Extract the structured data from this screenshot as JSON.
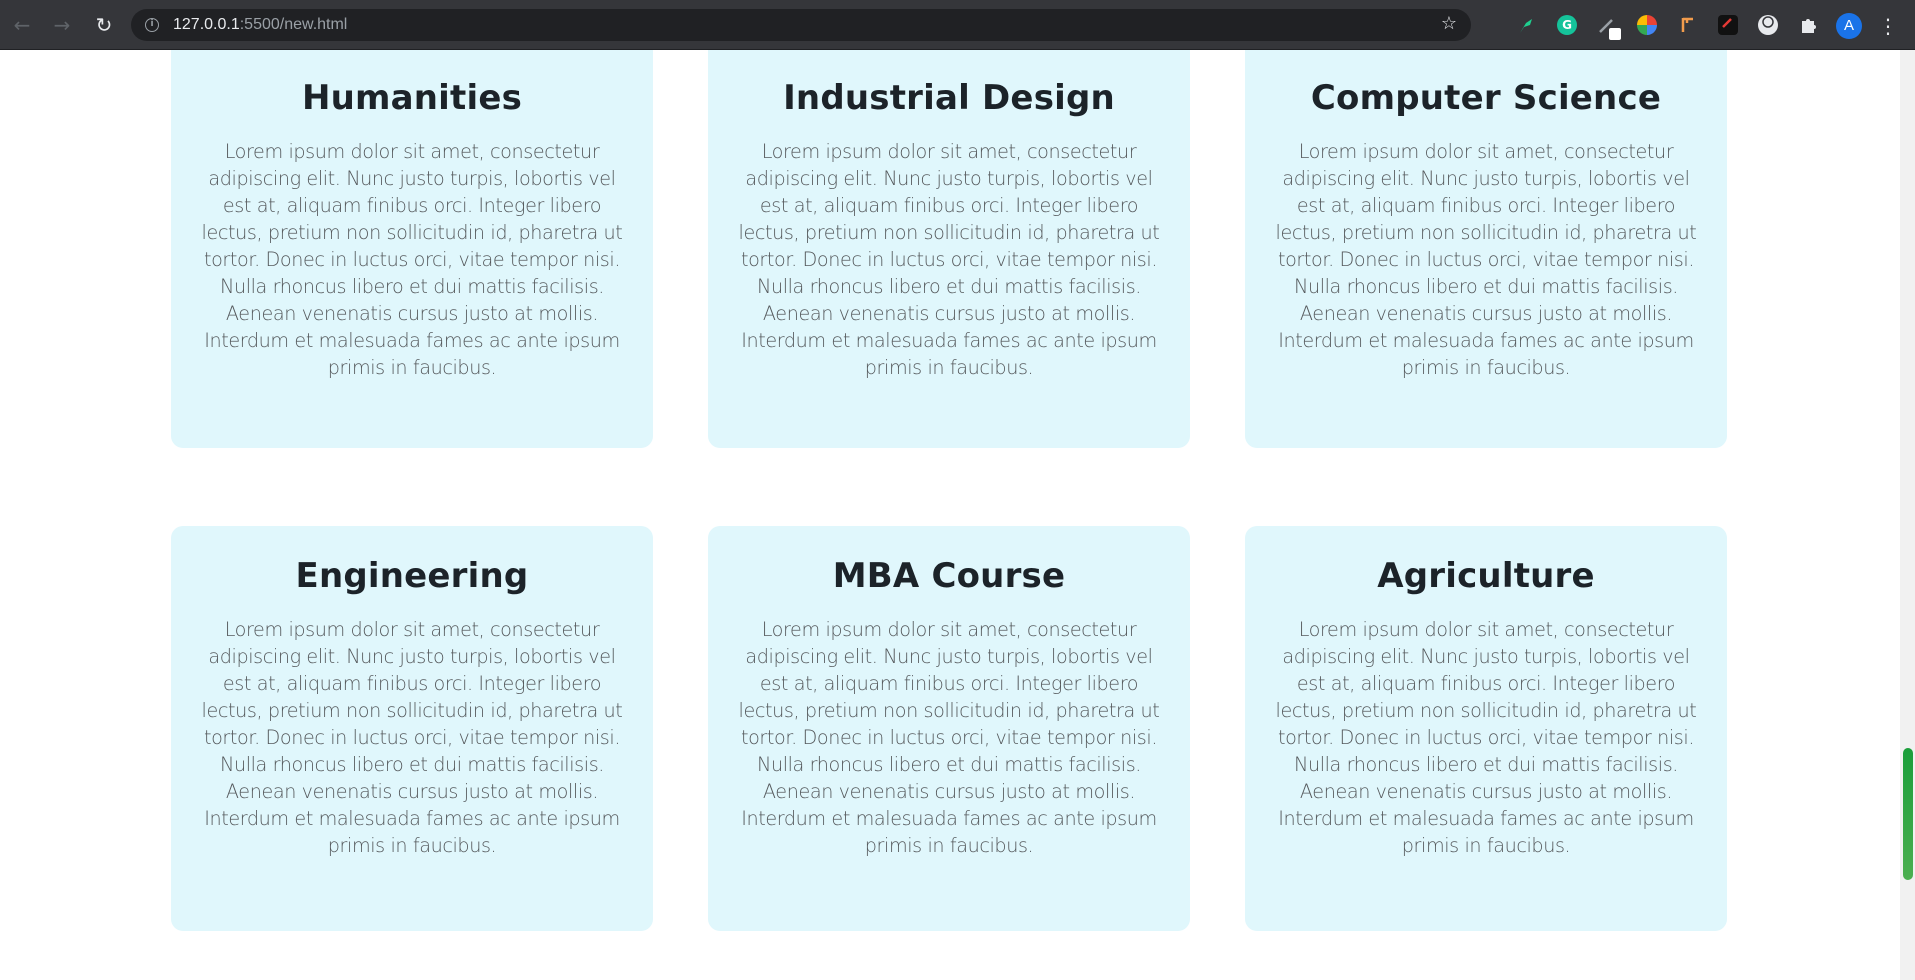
{
  "browser": {
    "url_host": "127.0.0.1",
    "url_rest": ":5500/new.html",
    "avatar_letter": "A",
    "icons": [
      "back-icon",
      "forward-icon",
      "reload-icon",
      "info-icon",
      "star-icon",
      "extension-puzzle-icon",
      "kebab-menu-icon"
    ],
    "glyphs": {
      "back": "←",
      "forward": "→",
      "reload": "↻",
      "info": "i",
      "star": "☆",
      "grammarly": "G",
      "puzzle": "✱",
      "menu": "⋮"
    }
  },
  "cards": [
    {
      "title": "Humanities",
      "text": "Lorem ipsum dolor sit amet, consectetur adipiscing elit. Nunc justo turpis, lobortis vel est at, aliquam finibus orci. Integer libero lectus, pretium non sollicitudin id, pharetra ut tortor. Donec in luctus orci, vitae tempor nisi. Nulla rhoncus libero et dui mattis facilisis. Aenean venenatis cursus justo at mollis. Interdum et malesuada fames ac ante ipsum primis in faucibus."
    },
    {
      "title": "Industrial Design",
      "text": "Lorem ipsum dolor sit amet, consectetur adipiscing elit. Nunc justo turpis, lobortis vel est at, aliquam finibus orci. Integer libero lectus, pretium non sollicitudin id, pharetra ut tortor. Donec in luctus orci, vitae tempor nisi. Nulla rhoncus libero et dui mattis facilisis. Aenean venenatis cursus justo at mollis. Interdum et malesuada fames ac ante ipsum primis in faucibus."
    },
    {
      "title": "Computer Science",
      "text": "Lorem ipsum dolor sit amet, consectetur adipiscing elit. Nunc justo turpis, lobortis vel est at, aliquam finibus orci. Integer libero lectus, pretium non sollicitudin id, pharetra ut tortor. Donec in luctus orci, vitae tempor nisi. Nulla rhoncus libero et dui mattis facilisis. Aenean venenatis cursus justo at mollis. Interdum et malesuada fames ac ante ipsum primis in faucibus."
    },
    {
      "title": "Engineering",
      "text": "Lorem ipsum dolor sit amet, consectetur adipiscing elit. Nunc justo turpis, lobortis vel est at, aliquam finibus orci. Integer libero lectus, pretium non sollicitudin id, pharetra ut tortor. Donec in luctus orci, vitae tempor nisi. Nulla rhoncus libero et dui mattis facilisis. Aenean venenatis cursus justo at mollis. Interdum et malesuada fames ac ante ipsum primis in faucibus."
    },
    {
      "title": "MBA Course",
      "text": "Lorem ipsum dolor sit amet, consectetur adipiscing elit. Nunc justo turpis, lobortis vel est at, aliquam finibus orci. Integer libero lectus, pretium non sollicitudin id, pharetra ut tortor. Donec in luctus orci, vitae tempor nisi. Nulla rhoncus libero et dui mattis facilisis. Aenean venenatis cursus justo at mollis. Interdum et malesuada fames ac ante ipsum primis in faucibus."
    },
    {
      "title": "Agriculture",
      "text": "Lorem ipsum dolor sit amet, consectetur adipiscing elit. Nunc justo turpis, lobortis vel est at, aliquam finibus orci. Integer libero lectus, pretium non sollicitudin id, pharetra ut tortor. Donec in luctus orci, vitae tempor nisi. Nulla rhoncus libero et dui mattis facilisis. Aenean venenatis cursus justo at mollis. Interdum et malesuada fames ac ante ipsum primis in faucibus."
    }
  ],
  "colors": {
    "card_background": "#e0f7fc",
    "title": "#1c2329",
    "body_text": "#55595c",
    "scrollbar_thumb": "#2ea043"
  }
}
